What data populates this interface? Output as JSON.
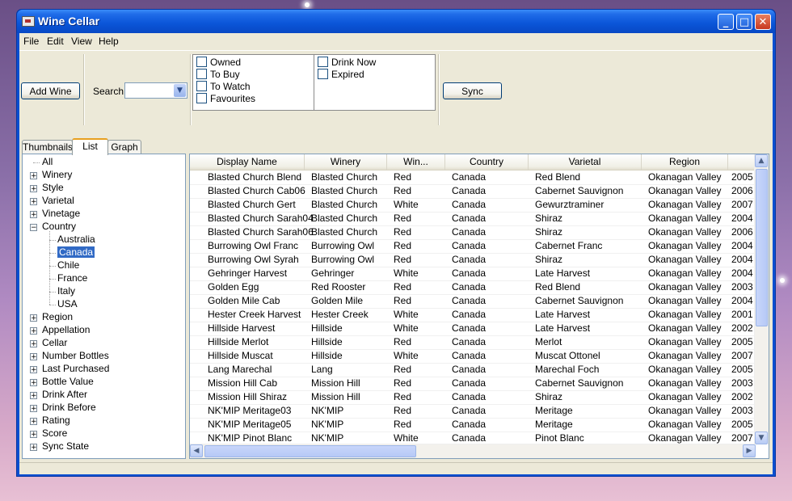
{
  "window": {
    "title": "Wine Cellar",
    "controls": [
      "_",
      "□",
      "✕"
    ]
  },
  "menu": [
    "File",
    "Edit",
    "View",
    "Help"
  ],
  "toolbar": {
    "add_wine": "Add Wine",
    "search_label": "Search:",
    "search_value": "",
    "filters_left": [
      "Owned",
      "To Buy",
      "To Watch",
      "Favourites"
    ],
    "filters_right": [
      "Drink Now",
      "Expired"
    ],
    "sync": "Sync"
  },
  "tabs": [
    "Thumbnails",
    "List",
    "Graph"
  ],
  "active_tab": "List",
  "tree": [
    {
      "label": "All",
      "level": 0,
      "expander": ""
    },
    {
      "label": "Winery",
      "level": 0,
      "expander": "+"
    },
    {
      "label": "Style",
      "level": 0,
      "expander": "+"
    },
    {
      "label": "Varietal",
      "level": 0,
      "expander": "+"
    },
    {
      "label": "Vinetage",
      "level": 0,
      "expander": "+"
    },
    {
      "label": "Country",
      "level": 0,
      "expander": "−"
    },
    {
      "label": "Australia",
      "level": 1,
      "expander": ""
    },
    {
      "label": "Canada",
      "level": 1,
      "expander": "",
      "selected": true
    },
    {
      "label": "Chile",
      "level": 1,
      "expander": ""
    },
    {
      "label": "France",
      "level": 1,
      "expander": ""
    },
    {
      "label": "Italy",
      "level": 1,
      "expander": ""
    },
    {
      "label": "USA",
      "level": 1,
      "expander": ""
    },
    {
      "label": "Region",
      "level": 0,
      "expander": "+"
    },
    {
      "label": "Appellation",
      "level": 0,
      "expander": "+"
    },
    {
      "label": "Cellar",
      "level": 0,
      "expander": "+"
    },
    {
      "label": "Number Bottles",
      "level": 0,
      "expander": "+"
    },
    {
      "label": "Last Purchased",
      "level": 0,
      "expander": "+"
    },
    {
      "label": "Bottle Value",
      "level": 0,
      "expander": "+"
    },
    {
      "label": "Drink After",
      "level": 0,
      "expander": "+"
    },
    {
      "label": "Drink Before",
      "level": 0,
      "expander": "+"
    },
    {
      "label": "Rating",
      "level": 0,
      "expander": "+"
    },
    {
      "label": "Score",
      "level": 0,
      "expander": "+"
    },
    {
      "label": "Sync State",
      "level": 0,
      "expander": "+"
    }
  ],
  "table": {
    "columns": [
      "Display Name",
      "Winery",
      "Win...",
      "Country",
      "Varietal",
      "Region",
      ""
    ],
    "rows": [
      [
        "Blasted Church Blend",
        "Blasted Church",
        "Red",
        "Canada",
        "Red Blend",
        "Okanagan Valley",
        "2005"
      ],
      [
        "Blasted Church Cab06",
        "Blasted Church",
        "Red",
        "Canada",
        "Cabernet Sauvignon",
        "Okanagan Valley",
        "2006"
      ],
      [
        "Blasted Church Gert",
        "Blasted Church",
        "White",
        "Canada",
        "Gewurztraminer",
        "Okanagan Valley",
        "2007"
      ],
      [
        "Blasted Church Sarah04",
        "Blasted Church",
        "Red",
        "Canada",
        "Shiraz",
        "Okanagan Valley",
        "2004"
      ],
      [
        "Blasted Church Sarah06",
        "Blasted Church",
        "Red",
        "Canada",
        "Shiraz",
        "Okanagan Valley",
        "2006"
      ],
      [
        "Burrowing Owl Franc",
        "Burrowing Owl",
        "Red",
        "Canada",
        "Cabernet Franc",
        "Okanagan Valley",
        "2004"
      ],
      [
        "Burrowing Owl Syrah",
        "Burrowing Owl",
        "Red",
        "Canada",
        "Shiraz",
        "Okanagan Valley",
        "2004"
      ],
      [
        "Gehringer Harvest",
        "Gehringer",
        "White",
        "Canada",
        "Late Harvest",
        "Okanagan Valley",
        "2004"
      ],
      [
        "Golden Egg",
        "Red Rooster",
        "Red",
        "Canada",
        "Red Blend",
        "Okanagan Valley",
        "2003"
      ],
      [
        "Golden Mile Cab",
        "Golden Mile",
        "Red",
        "Canada",
        "Cabernet Sauvignon",
        "Okanagan Valley",
        "2004"
      ],
      [
        "Hester Creek Harvest",
        "Hester Creek",
        "White",
        "Canada",
        "Late Harvest",
        "Okanagan Valley",
        "2001"
      ],
      [
        "Hillside Harvest",
        "Hillside",
        "White",
        "Canada",
        "Late Harvest",
        "Okanagan Valley",
        "2002"
      ],
      [
        "Hillside Merlot",
        "Hillside",
        "Red",
        "Canada",
        "Merlot",
        "Okanagan Valley",
        "2005"
      ],
      [
        "Hillside Muscat",
        "Hillside",
        "White",
        "Canada",
        "Muscat Ottonel",
        "Okanagan Valley",
        "2007"
      ],
      [
        "Lang Marechal",
        "Lang",
        "Red",
        "Canada",
        "Marechal Foch",
        "Okanagan Valley",
        "2005"
      ],
      [
        "Mission Hill Cab",
        "Mission Hill",
        "Red",
        "Canada",
        "Cabernet Sauvignon",
        "Okanagan Valley",
        "2003"
      ],
      [
        "Mission Hill Shiraz",
        "Mission Hill",
        "Red",
        "Canada",
        "Shiraz",
        "Okanagan Valley",
        "2002"
      ],
      [
        "NK'MIP Meritage03",
        "NK'MIP",
        "Red",
        "Canada",
        "Meritage",
        "Okanagan Valley",
        "2003"
      ],
      [
        "NK'MIP Meritage05",
        "NK'MIP",
        "Red",
        "Canada",
        "Meritage",
        "Okanagan Valley",
        "2005"
      ],
      [
        "NK'MIP Pinot Blanc",
        "NK'MIP",
        "White",
        "Canada",
        "Pinot Blanc",
        "Okanagan Valley",
        "2007"
      ]
    ]
  },
  "colors": {
    "titlebar": "#0a55d8",
    "selection": "#316ac5",
    "tab_accent": "#e8a020"
  }
}
